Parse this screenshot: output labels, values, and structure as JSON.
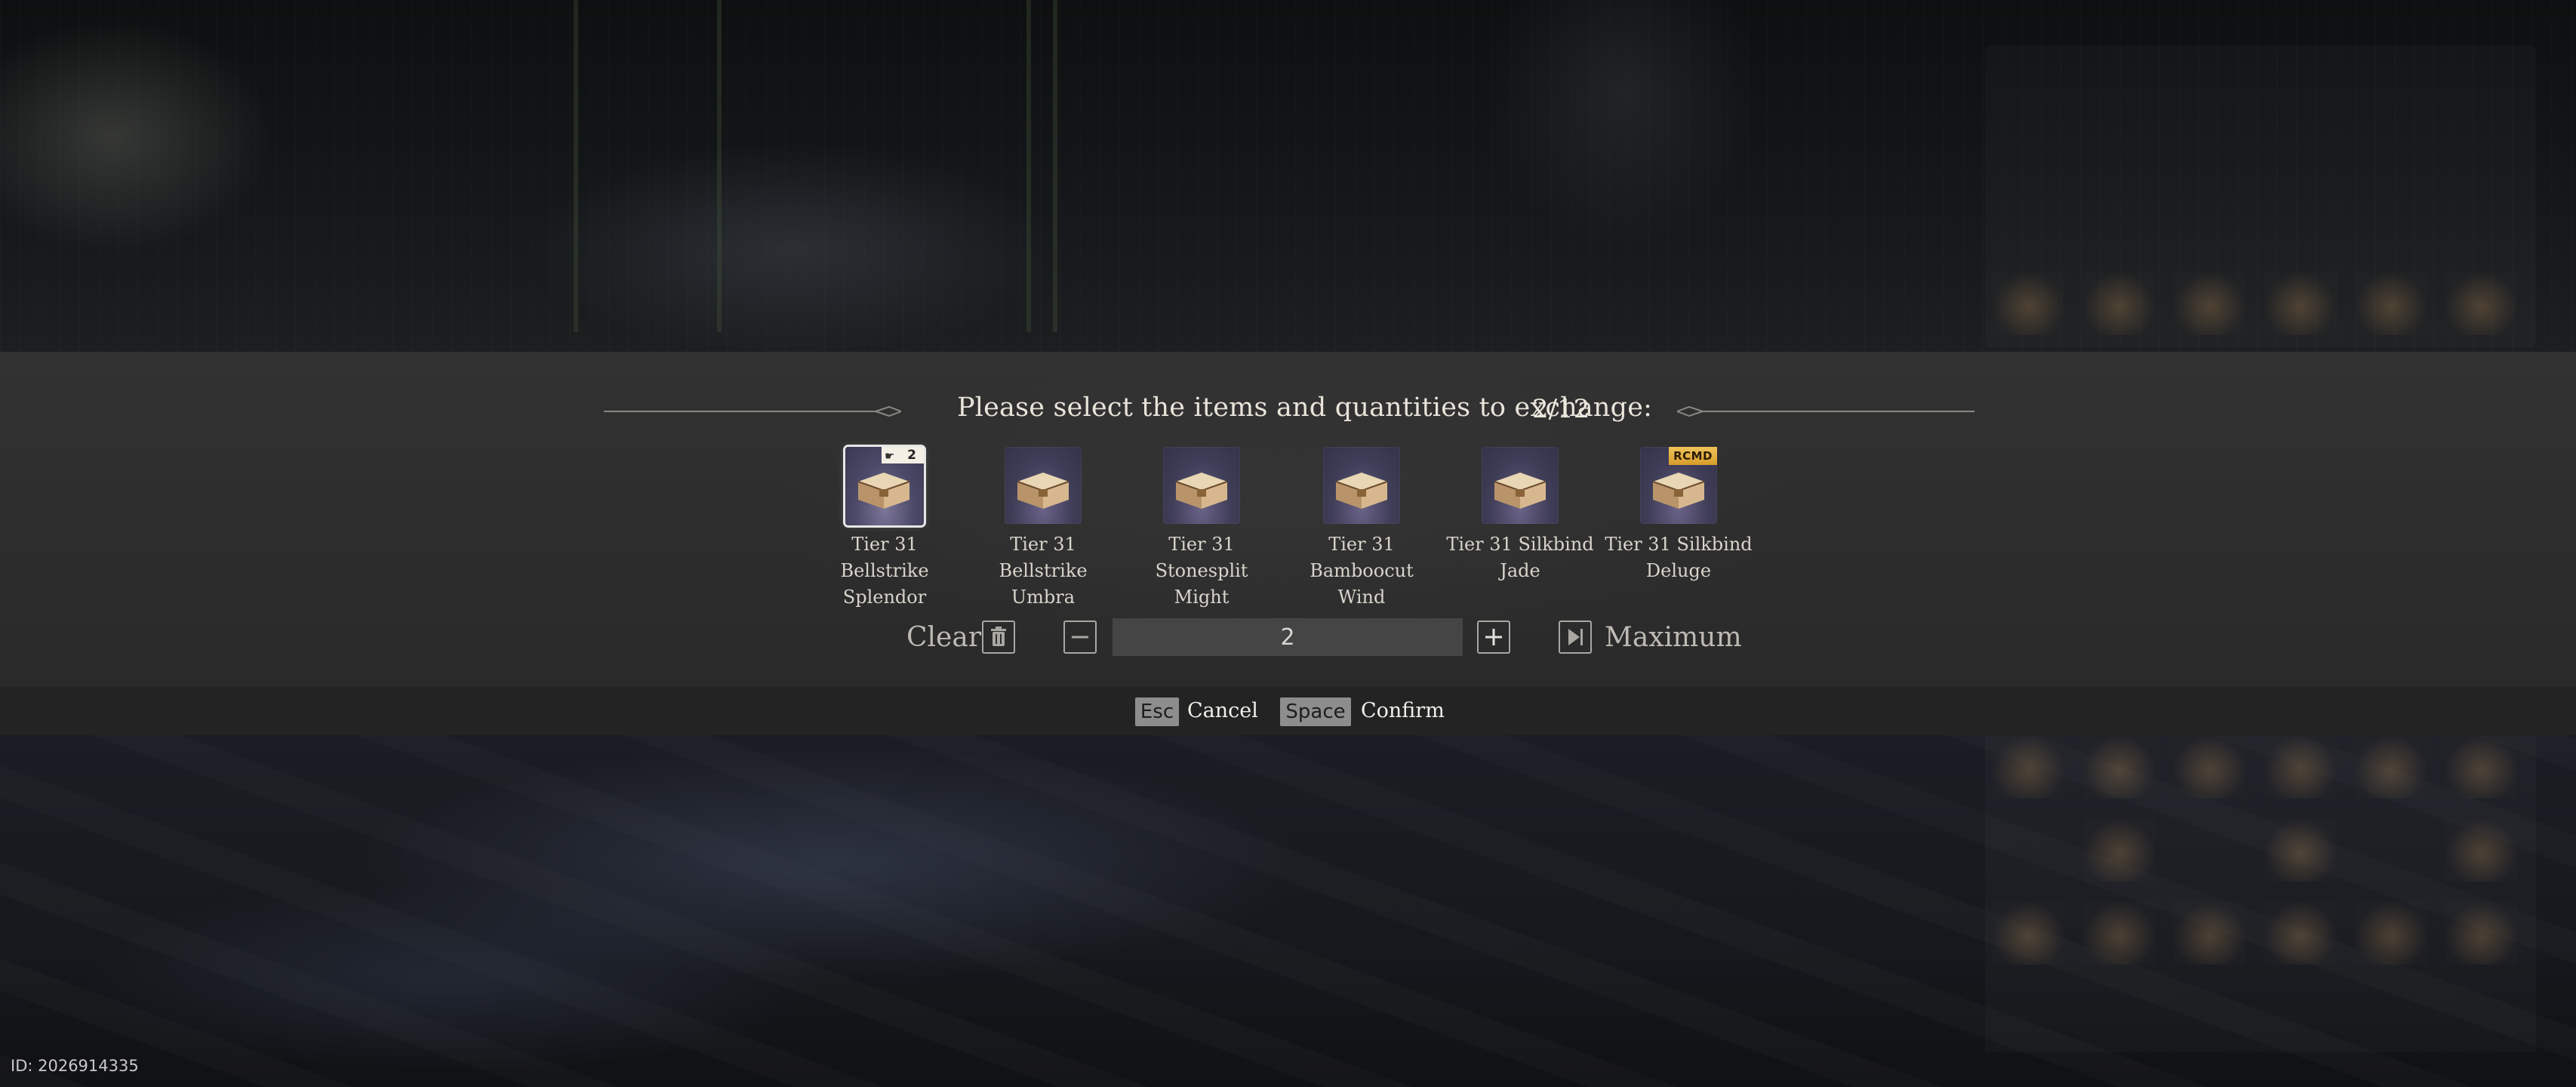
{
  "dialog": {
    "prompt": "Please select the items and quantities to exchange:",
    "selection_count": "2/12"
  },
  "items": [
    {
      "label": "Tier 31 Bellstrike Splendor",
      "selected": true,
      "quantity": "2",
      "icon": "chest-icon"
    },
    {
      "label": "Tier 31 Bellstrike Umbra",
      "selected": false,
      "icon": "chest-icon"
    },
    {
      "label": "Tier 31 Stonesplit Might",
      "selected": false,
      "icon": "chest-icon"
    },
    {
      "label": "Tier 31 Bamboocut Wind",
      "selected": false,
      "icon": "chest-icon"
    },
    {
      "label": "Tier 31 Silkbind Jade",
      "selected": false,
      "icon": "chest-icon"
    },
    {
      "label": "Tier 31 Silkbind Deluge",
      "selected": false,
      "badge": "RCMD",
      "icon": "chest-icon"
    }
  ],
  "controls": {
    "clear_label": "Clear",
    "quantity_value": "2",
    "maximum_label": "Maximum"
  },
  "footer": {
    "cancel_key": "Esc",
    "cancel_label": "Cancel",
    "confirm_key": "Space",
    "confirm_label": "Confirm"
  },
  "player_id": "ID: 2026914335",
  "colors": {
    "badge_gold": "#e0a83a",
    "selected_border": "#e6e6e6",
    "panel_bg": "#2f2f2f"
  }
}
